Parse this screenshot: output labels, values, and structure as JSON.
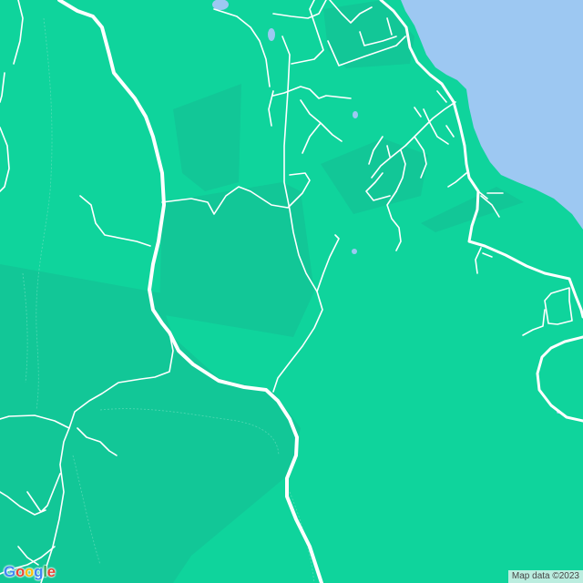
{
  "map": {
    "colors": {
      "land": "#0fd49c",
      "forest": "#12c797",
      "water": "#9dc8f2",
      "road": "#ffffff"
    }
  },
  "logo": {
    "text": "Google",
    "letter_colors": [
      "#4285f4",
      "#ea4335",
      "#fbbc05",
      "#4285f4",
      "#34a853",
      "#ea4335"
    ]
  },
  "attribution": {
    "text": "Map data ©2023"
  }
}
